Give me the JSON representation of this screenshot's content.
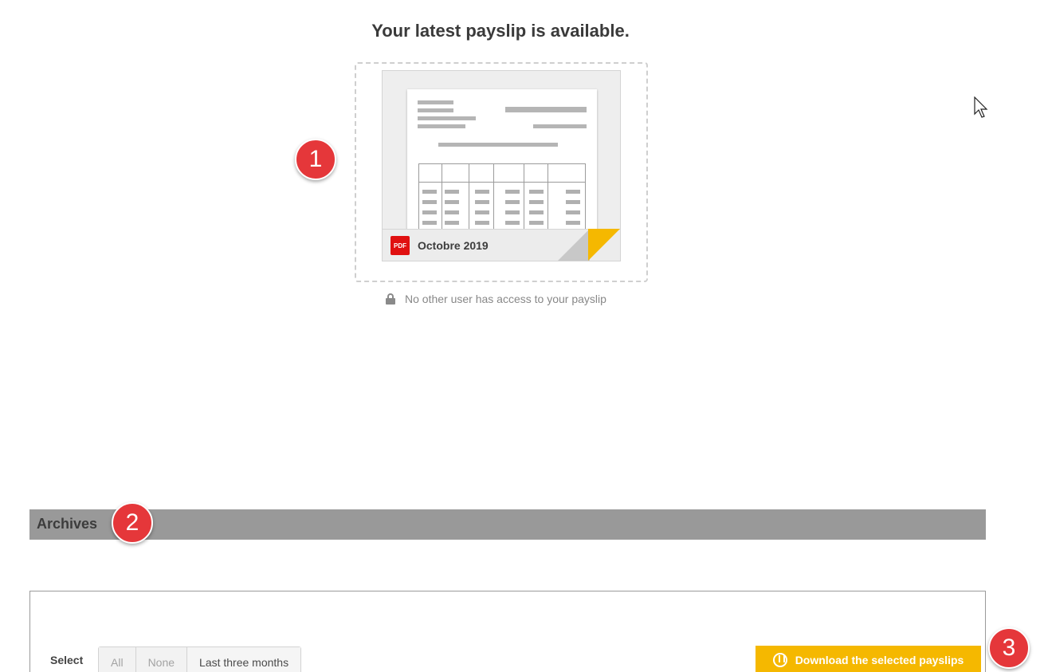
{
  "latest": {
    "headline": "Your latest payslip is available.",
    "month": "Octobre 2019",
    "file_badge": "PDF",
    "access_note": "No other user has access to your payslip"
  },
  "markers": {
    "one": "1",
    "two": "2",
    "three": "3"
  },
  "archives": {
    "title": "Archives",
    "select_label": "Select",
    "select_options": [
      {
        "label": "All",
        "enabled": false
      },
      {
        "label": "None",
        "enabled": false
      },
      {
        "label": "Last three months",
        "enabled": true
      }
    ],
    "download_button": "Download the selected payslips"
  },
  "colors": {
    "accent": "#f5b800",
    "marker": "#e5373a",
    "pdf": "#e01010",
    "archives_bar": "#999999"
  },
  "icons": [
    "lock-icon",
    "pdf-icon",
    "download-icon",
    "mouse-cursor-icon"
  ]
}
